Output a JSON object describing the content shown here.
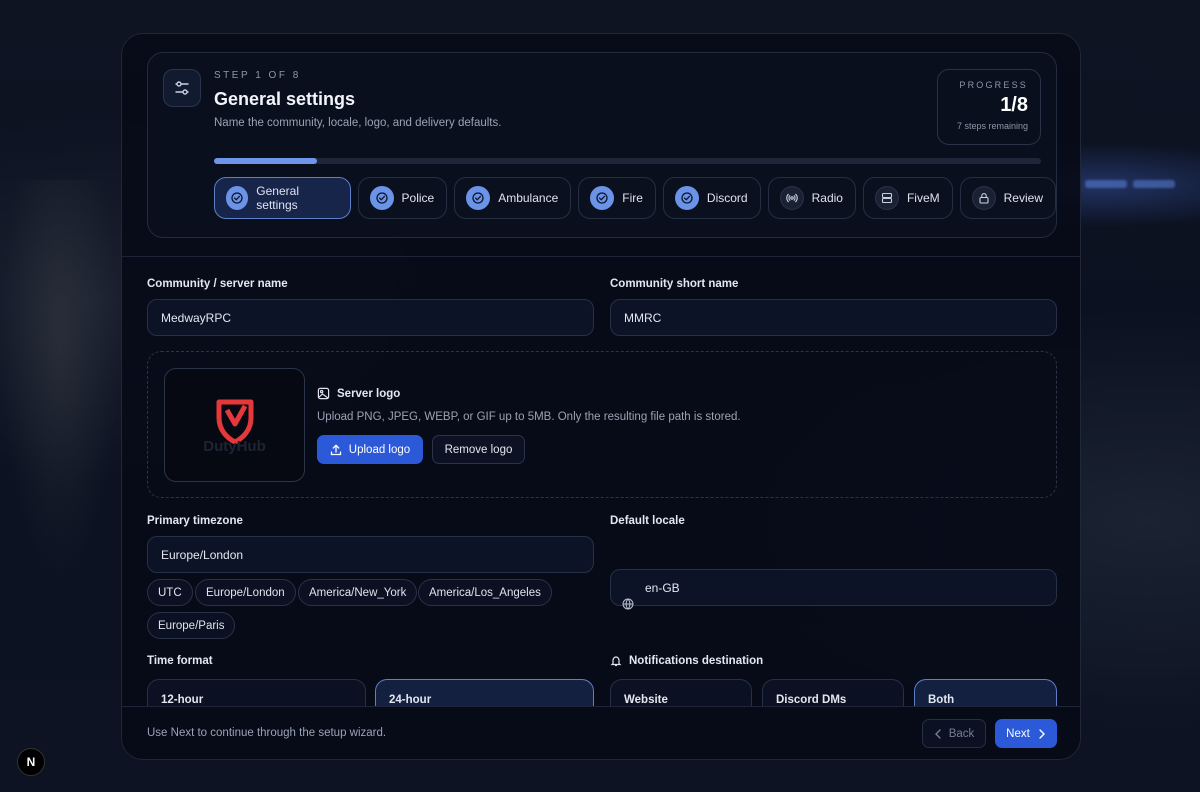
{
  "header": {
    "step_label": "STEP 1 OF 8",
    "title": "General settings",
    "subtitle": "Name the community, locale, logo, and delivery defaults.",
    "progress_label": "PROGRESS",
    "progress_value": "1/8",
    "progress_remaining": "7 steps remaining",
    "progress_fraction": 0.125
  },
  "steps": [
    {
      "label": "General settings",
      "icon": "check-circle-icon",
      "status": "active"
    },
    {
      "label": "Police",
      "icon": "check-circle-icon",
      "status": "done"
    },
    {
      "label": "Ambulance",
      "icon": "check-circle-icon",
      "status": "done"
    },
    {
      "label": "Fire",
      "icon": "check-circle-icon",
      "status": "done"
    },
    {
      "label": "Discord",
      "icon": "check-circle-icon",
      "status": "done"
    },
    {
      "label": "Radio",
      "icon": "radio-icon",
      "status": "todo"
    },
    {
      "label": "FiveM",
      "icon": "server-icon",
      "status": "todo"
    },
    {
      "label": "Review",
      "icon": "lock-icon",
      "status": "todo"
    }
  ],
  "form": {
    "community_name_label": "Community / server name",
    "community_name_value": "MedwayRPC",
    "short_name_label": "Community short name",
    "short_name_value": "MMRC",
    "logo": {
      "title": "Server logo",
      "description": "Upload PNG, JPEG, WEBP, or GIF up to 5MB. Only the resulting file path is stored.",
      "upload_label": "Upload logo",
      "remove_label": "Remove logo",
      "preview_text": "DutyHub"
    },
    "timezone_label": "Primary timezone",
    "timezone_value": "Europe/London",
    "timezone_chips": [
      "UTC",
      "Europe/London",
      "America/New_York",
      "America/Los_Angeles",
      "Europe/Paris"
    ],
    "locale_label": "Default locale",
    "locale_value": "en-GB",
    "time_format_label": "Time format",
    "time_format_options": [
      "12-hour",
      "24-hour"
    ],
    "time_format_selected": "24-hour",
    "notifications_label": "Notifications destination",
    "notifications_options": [
      "Website",
      "Discord DMs",
      "Both"
    ],
    "notifications_selected": "Both"
  },
  "footer": {
    "hint": "Use Next to continue through the setup wizard.",
    "back_label": "Back",
    "next_label": "Next"
  },
  "badge": "N",
  "colors": {
    "accent": "#2b59d8",
    "step_done": "#6b94e8",
    "logo_red": "#e5383b"
  }
}
